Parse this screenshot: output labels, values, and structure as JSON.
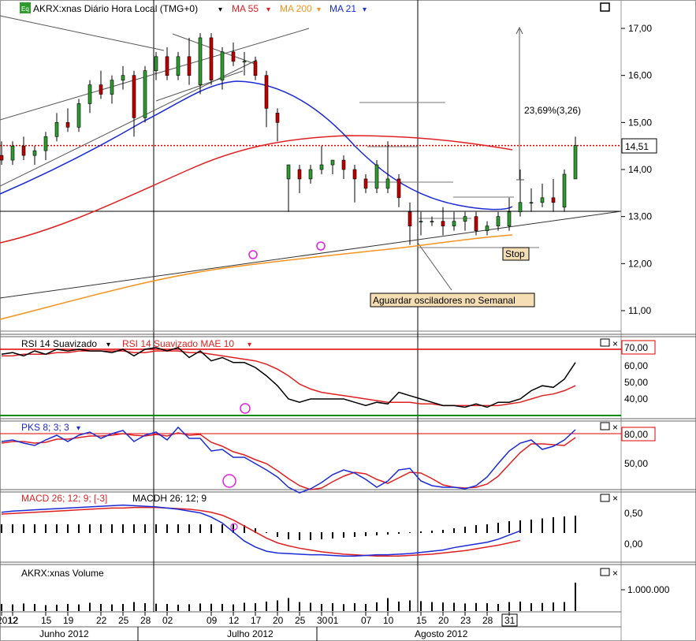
{
  "colors": {
    "up": "#2e9b2e",
    "down": "#c00000",
    "ma55": "#e02020",
    "ma200": "#f7931e",
    "ma21": "#1a2bd6",
    "rsi": "#000000",
    "rsiMae": "#e02020",
    "pksK": "#1a2bd6",
    "pksD": "#e02020",
    "macd": "#1a2bd6",
    "signal": "#e02020",
    "rsiHigh": "#e00000",
    "rsiLow": "#0a8a0a",
    "badgeFill": "#f5deb3"
  },
  "header": {
    "icon_label": "Eq",
    "symbol_label": "AKRX:xnas Diário Hora Local (TMG+0)",
    "ma55_label": "MA 55",
    "ma200_label": "MA 200",
    "ma21_label": "MA 21"
  },
  "price_axis": {
    "ticks": [
      "17,00",
      "16,00",
      "15,00",
      "14,00",
      "13,00",
      "12,00",
      "11,00"
    ],
    "current": "14,51"
  },
  "annotations": {
    "pct_change": "23,69%(3,26)",
    "stop": "Stop",
    "wait": "Aguardar osciladores no Semanal"
  },
  "rsi": {
    "title": "RSI 14 Suavizado",
    "mae_title": "RSI 14 Suavizado MAE 10",
    "ticks": [
      "70,00",
      "60,00",
      "50,00",
      "40,00"
    ]
  },
  "pks": {
    "title": "PKS 8; 3; 3",
    "ticks": [
      "80,00",
      "50,00"
    ]
  },
  "macd": {
    "title": "MACD 26; 12; 9; [-3]",
    "hist_title": "MACDH 26; 12; 9",
    "ticks": [
      "0,50",
      "0,00"
    ]
  },
  "volume": {
    "title": "AKRX:xnas Volume",
    "ticks": [
      "1.000.000"
    ]
  },
  "x_axis": {
    "day_labels": [
      {
        "i": 0,
        "t": "2012"
      },
      {
        "i": 1,
        "t": "12"
      },
      {
        "i": 4,
        "t": "15"
      },
      {
        "i": 6,
        "t": "19"
      },
      {
        "i": 9,
        "t": "22"
      },
      {
        "i": 11,
        "t": "25"
      },
      {
        "i": 13,
        "t": "28"
      },
      {
        "i": 15,
        "t": "02"
      },
      {
        "i": 19,
        "t": "09"
      },
      {
        "i": 21,
        "t": "12"
      },
      {
        "i": 23,
        "t": "17"
      },
      {
        "i": 25,
        "t": "20"
      },
      {
        "i": 27,
        "t": "25"
      },
      {
        "i": 29,
        "t": "30"
      },
      {
        "i": 30,
        "t": "01"
      },
      {
        "i": 33,
        "t": "07"
      },
      {
        "i": 35,
        "t": "10"
      },
      {
        "i": 38,
        "t": "15"
      },
      {
        "i": 40,
        "t": "20"
      },
      {
        "i": 42,
        "t": "23"
      },
      {
        "i": 44,
        "t": "28"
      },
      {
        "i": 46,
        "t": "31"
      }
    ],
    "months": [
      {
        "t": "Junho 2012",
        "i": 4
      },
      {
        "t": "Julho 2012",
        "i": 21
      },
      {
        "t": "Agosto 2012",
        "i": 38
      }
    ]
  },
  "chart_data": {
    "type": "candlestick",
    "title": "AKRX:xnas Diário Hora Local (TMG+0)",
    "date_start": "2012-06-11",
    "date_end": "2012-08-31",
    "ohlc": [
      [
        14.3,
        14.6,
        14.1,
        14.2
      ],
      [
        14.2,
        14.6,
        14.1,
        14.5
      ],
      [
        14.5,
        14.7,
        14.2,
        14.3
      ],
      [
        14.3,
        14.5,
        14.1,
        14.4
      ],
      [
        14.4,
        14.8,
        14.2,
        14.7
      ],
      [
        14.7,
        15.2,
        14.6,
        15.0
      ],
      [
        15.0,
        15.3,
        14.8,
        14.9
      ],
      [
        14.9,
        15.5,
        14.8,
        15.4
      ],
      [
        15.4,
        15.9,
        15.2,
        15.8
      ],
      [
        15.8,
        16.1,
        15.5,
        15.6
      ],
      [
        15.6,
        16.0,
        15.4,
        15.9
      ],
      [
        15.9,
        16.2,
        15.7,
        16.0
      ],
      [
        16.0,
        16.1,
        14.7,
        15.1
      ],
      [
        15.1,
        16.2,
        15.0,
        16.1
      ],
      [
        16.1,
        16.5,
        15.9,
        16.4
      ],
      [
        16.4,
        16.6,
        15.9,
        16.0
      ],
      [
        16.0,
        16.5,
        15.9,
        16.4
      ],
      [
        16.4,
        16.8,
        15.8,
        16.0
      ],
      [
        15.8,
        16.9,
        15.6,
        16.8
      ],
      [
        16.8,
        16.9,
        15.8,
        15.9
      ],
      [
        15.9,
        16.6,
        15.7,
        16.5
      ],
      [
        16.5,
        16.7,
        16.2,
        16.3
      ],
      [
        16.3,
        16.5,
        16.0,
        16.3
      ],
      [
        16.3,
        16.4,
        15.9,
        16.0
      ],
      [
        16.0,
        16.1,
        14.9,
        15.3
      ],
      [
        15.2,
        15.3,
        14.6,
        15.0
      ],
      [
        13.8,
        14.1,
        13.1,
        14.1
      ],
      [
        14.0,
        14.1,
        13.5,
        13.8
      ],
      [
        13.8,
        14.1,
        13.7,
        14.0
      ],
      [
        14.0,
        14.5,
        13.9,
        14.1
      ],
      [
        14.1,
        14.2,
        13.9,
        14.2
      ],
      [
        14.2,
        14.3,
        13.8,
        14.0
      ],
      [
        14.0,
        14.1,
        13.3,
        13.8
      ],
      [
        13.8,
        13.9,
        13.5,
        13.6
      ],
      [
        13.6,
        14.2,
        13.5,
        14.1
      ],
      [
        13.6,
        14.6,
        13.5,
        13.8
      ],
      [
        13.8,
        13.9,
        13.2,
        13.4
      ],
      [
        13.1,
        13.3,
        12.4,
        12.8
      ],
      [
        12.9,
        13.1,
        12.6,
        12.9
      ],
      [
        12.9,
        13.0,
        12.8,
        12.9
      ],
      [
        12.9,
        13.2,
        12.6,
        12.8
      ],
      [
        12.8,
        13.1,
        12.7,
        12.9
      ],
      [
        12.9,
        13.1,
        12.7,
        13.0
      ],
      [
        13.0,
        13.1,
        12.6,
        12.7
      ],
      [
        12.7,
        12.9,
        12.6,
        12.8
      ],
      [
        12.8,
        13.1,
        12.7,
        13.0
      ],
      [
        12.8,
        13.4,
        12.7,
        13.1
      ],
      [
        13.1,
        14.0,
        13.0,
        13.3
      ],
      [
        13.3,
        13.6,
        13.1,
        13.3
      ],
      [
        13.3,
        13.7,
        13.2,
        13.4
      ],
      [
        13.4,
        13.8,
        13.1,
        13.3
      ],
      [
        13.2,
        14.0,
        13.1,
        13.9
      ],
      [
        13.8,
        14.7,
        13.8,
        14.51
      ]
    ],
    "volume": [
      0.3,
      0.28,
      0.32,
      0.3,
      0.25,
      0.27,
      0.3,
      0.28,
      0.35,
      0.3,
      0.28,
      0.3,
      0.38,
      0.33,
      0.31,
      0.3,
      0.27,
      0.29,
      0.32,
      0.31,
      0.3,
      0.28,
      0.35,
      0.33,
      0.4,
      0.45,
      0.55,
      0.38,
      0.35,
      0.3,
      0.33,
      0.29,
      0.33,
      0.3,
      0.37,
      0.55,
      0.4,
      0.45,
      0.42,
      0.38,
      0.36,
      0.35,
      0.32,
      0.34,
      0.33,
      0.3,
      0.38,
      0.4,
      0.33,
      0.34,
      0.36,
      0.38,
      1.2
    ],
    "rsi": [
      67,
      68,
      66,
      69,
      67,
      70,
      69,
      70,
      69,
      69,
      68,
      70,
      66,
      70,
      71,
      69,
      71,
      65,
      69,
      63,
      65,
      62,
      62,
      59,
      54,
      48,
      40,
      38,
      40,
      40,
      40,
      40,
      38,
      36,
      38,
      37,
      44,
      42,
      40,
      38,
      36,
      36,
      35,
      37,
      35,
      38,
      38,
      40,
      45,
      48,
      47,
      52,
      62
    ],
    "rsi_mae": [
      66,
      66,
      67,
      67,
      67,
      68,
      68,
      69,
      69,
      69,
      69,
      69,
      68,
      68,
      69,
      69,
      69,
      68,
      68,
      67,
      66,
      65,
      64,
      63,
      61,
      58,
      54,
      49,
      46,
      44,
      43,
      42,
      41,
      40,
      39,
      38,
      38,
      38,
      37,
      37,
      36,
      36,
      36,
      36,
      36,
      36,
      37,
      38,
      40,
      42,
      43,
      45,
      48
    ],
    "pks_k": [
      70,
      72,
      68,
      65,
      72,
      78,
      70,
      78,
      82,
      74,
      80,
      84,
      70,
      78,
      82,
      72,
      88,
      74,
      74,
      58,
      60,
      50,
      50,
      42,
      34,
      25,
      12,
      5,
      10,
      18,
      28,
      34,
      30,
      22,
      12,
      20,
      34,
      36,
      20,
      14,
      12,
      12,
      10,
      14,
      25,
      42,
      58,
      68,
      72,
      60,
      64,
      72,
      85
    ],
    "pks_d": [
      68,
      70,
      70,
      68,
      69,
      73,
      73,
      75,
      77,
      77,
      78,
      80,
      78,
      77,
      79,
      77,
      81,
      78,
      79,
      69,
      64,
      57,
      53,
      47,
      42,
      33,
      23,
      14,
      9,
      11,
      19,
      26,
      31,
      29,
      22,
      17,
      24,
      31,
      30,
      23,
      15,
      12,
      11,
      12,
      16,
      26,
      41,
      56,
      67,
      67,
      66,
      65,
      75
    ],
    "macd": [
      0.53,
      0.55,
      0.56,
      0.57,
      0.58,
      0.59,
      0.6,
      0.61,
      0.62,
      0.63,
      0.64,
      0.65,
      0.64,
      0.63,
      0.62,
      0.6,
      0.58,
      0.55,
      0.52,
      0.45,
      0.35,
      0.2,
      0.05,
      -0.05,
      -0.12,
      -0.15,
      -0.16,
      -0.17,
      -0.18,
      -0.18,
      -0.19,
      -0.2,
      -0.2,
      -0.19,
      -0.18,
      -0.18,
      -0.17,
      -0.16,
      -0.14,
      -0.12,
      -0.1,
      -0.06,
      -0.03,
      0.0,
      0.03,
      0.08,
      0.15,
      0.22
    ],
    "signal": [
      0.5,
      0.51,
      0.52,
      0.53,
      0.54,
      0.55,
      0.56,
      0.57,
      0.58,
      0.59,
      0.6,
      0.6,
      0.61,
      0.61,
      0.61,
      0.6,
      0.59,
      0.58,
      0.56,
      0.53,
      0.48,
      0.4,
      0.3,
      0.2,
      0.1,
      0.02,
      -0.03,
      -0.07,
      -0.1,
      -0.13,
      -0.15,
      -0.17,
      -0.18,
      -0.19,
      -0.2,
      -0.2,
      -0.2,
      -0.19,
      -0.18,
      -0.17,
      -0.15,
      -0.13,
      -0.11,
      -0.08,
      -0.05,
      -0.02,
      0.02,
      0.06
    ],
    "macd_hist": [
      0.2,
      0.2,
      0.2,
      0.2,
      0.2,
      0.2,
      0.2,
      0.2,
      0.2,
      0.2,
      0.2,
      0.2,
      0.2,
      0.2,
      0.2,
      0.2,
      0.2,
      0.2,
      0.2,
      0.2,
      0.2,
      0.2,
      0.18,
      0.1,
      0.0,
      -0.1,
      -0.16,
      -0.18,
      -0.18,
      -0.16,
      -0.14,
      -0.12,
      -0.1,
      -0.08,
      -0.06,
      -0.04,
      -0.02,
      0.0,
      0.02,
      0.04,
      0.06,
      0.1,
      0.14,
      0.18,
      0.2,
      0.24,
      0.28,
      0.3,
      0.32,
      0.35,
      0.38,
      0.4,
      0.42
    ],
    "price_ylim": [
      10.6,
      17.6
    ],
    "rsi_levels": [
      70,
      30
    ],
    "pks_level": 80
  }
}
